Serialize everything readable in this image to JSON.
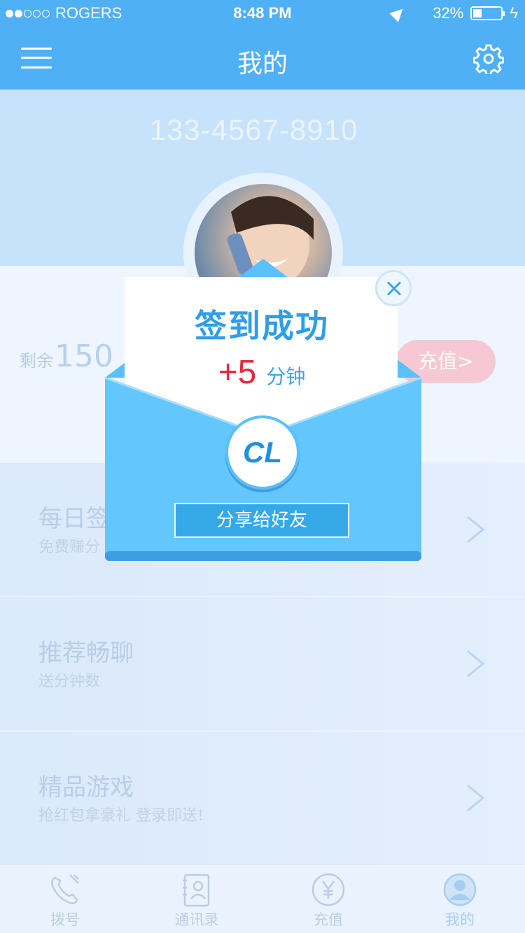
{
  "status_bar": {
    "carrier": "ROGERS",
    "time": "8:48 PM",
    "battery": "32%",
    "battery_level": 0.32,
    "signal_bars": 2
  },
  "header": {
    "title": "我的"
  },
  "profile": {
    "phone": "133-4567-8910",
    "remain_label": "剩余",
    "remain_value": "150",
    "recharge_label": "充值>"
  },
  "list": [
    {
      "title": "每日签",
      "subtitle": "免费赚分"
    },
    {
      "title": "推荐畅聊",
      "subtitle": "送分钟数"
    },
    {
      "title": "精品游戏",
      "subtitle": "抢红包拿豪礼 登录即送!"
    }
  ],
  "tabs": [
    {
      "label": "拨号",
      "icon": "dial-icon"
    },
    {
      "label": "通讯录",
      "icon": "contacts-icon"
    },
    {
      "label": "充值",
      "icon": "yuan-icon"
    },
    {
      "label": "我的",
      "icon": "user-icon"
    }
  ],
  "modal": {
    "title": "签到成功",
    "gain_value": "+5",
    "gain_unit": "分钟",
    "logo_text": "CL",
    "share_label": "分享给好友"
  },
  "colors": {
    "primary": "#4fb0f6",
    "accent_red": "#e8263f",
    "envelope": "#5bbff9"
  }
}
